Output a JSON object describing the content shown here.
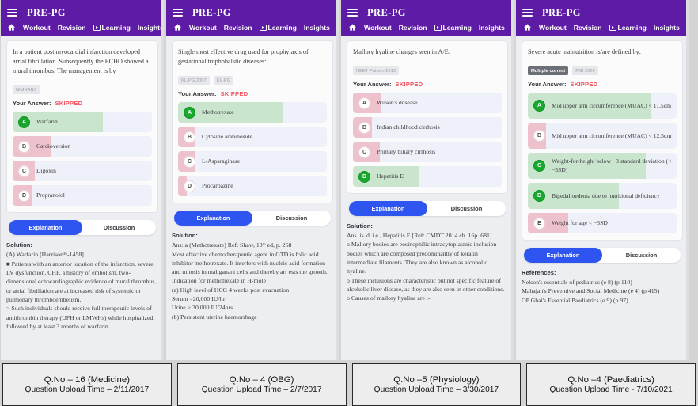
{
  "app": {
    "brand": "PRE-PG",
    "menu_icon": "hamburger-icon",
    "nav": [
      {
        "label": "Workout",
        "icon": ""
      },
      {
        "label": "Revision",
        "icon": ""
      },
      {
        "label": "Learning",
        "icon": "play-video-icon"
      },
      {
        "label": "Insights",
        "icon": ""
      }
    ],
    "home_icon": "home-icon",
    "answer_label": "Your Answer:",
    "answer_value": "SKIPPED",
    "tab_explanation": "Explanation",
    "tab_discussion": "Discussion",
    "solution_heading": "Solution:",
    "references_heading": "References:"
  },
  "colors": {
    "appbar_purple": "#5d1ba6",
    "correct_green": "#17a82e",
    "correct_fill": "#c9e5ce",
    "wrong_fill": "#eec2cd",
    "option_bg": "#eef1f9",
    "active_tab_blue": "#2f55f0",
    "skipped_red": "#f4525f"
  },
  "panels": [
    {
      "question": "In a patient post myocardial infarction developed arrial fibrillation. Subsequently the ECHO showed a mural thrombus. The management is by",
      "tags": [
        {
          "text": "NIMHANS",
          "dark": false
        }
      ],
      "options": [
        {
          "key": "A",
          "text": "Warfarin",
          "state": "correct",
          "fill": 65
        },
        {
          "key": "B",
          "text": "Cardioversion",
          "state": "wrong",
          "fill": 28
        },
        {
          "key": "C",
          "text": "Digoxin",
          "state": "wrong",
          "fill": 16
        },
        {
          "key": "D",
          "text": "Propranolol",
          "state": "wrong",
          "fill": 14
        }
      ],
      "solution_heading": "Solution:",
      "solution": "(A) Warfarin [Harrison¹⁶-1458]\n■ Patients with an anterior location of the infarction, severe LV dysfunction, CHF, a history of embolism, two-dimensional echocardiographic evidence of mural thrombus, or atrial fibrillation are at increased risk of systemic or pulmonary thromboembeiism.\n> Such individuals should receive full therapeutic levels of antithrombin therapy (UFH or LMWHs) while hospitalized, followed by at least 3 months of warfarin",
      "caption_line1": "Q.No – 16 (Medicine)",
      "caption_line2": "Question Upload Time – 2/11/2017"
    },
    {
      "question": "Single most effective drug used for prophylaxis of gestational trophobalstic diseases:",
      "tags": [
        {
          "text": "KL-PG 2007",
          "dark": false
        },
        {
          "text": "KL-PG",
          "dark": false
        }
      ],
      "options": [
        {
          "key": "A",
          "text": "Methotrexate",
          "state": "correct",
          "fill": 71
        },
        {
          "key": "B",
          "text": "Cytosine arabinoside",
          "state": "wrong",
          "fill": 11
        },
        {
          "key": "C",
          "text": "L-Asparaginase",
          "state": "wrong",
          "fill": 11
        },
        {
          "key": "D",
          "text": "Procarbazine",
          "state": "wrong",
          "fill": 6
        }
      ],
      "solution_heading": "Solution:",
      "solution": "Ans: a (Methotrexate) Ref: Shaw, 13ᵗʰ ed, p. 258\nMost effective chemotherapeutic agent in GTD is folic acid inhibitor methotrexate. It interfers with nucleic acid formation and mitosis in maliganant cells and thereby arr ests the growth.\nIndication for methotrexate in H-mole\n(a) High level of HCG 4 weeks post evacuation\nSerum >20,000 IU/ltr\nUrine > 30,000 IU/24hrs\n(b) Persistent uterine haemorrhage",
      "caption_line1": "Q.No – 4 (OBG)",
      "caption_line2": "Question Upload Time – 2/7/2017"
    },
    {
      "question": "Mallory hyaline changes seen in A/E:",
      "tags": [
        {
          "text": "NEET Pattern 2015",
          "dark": false
        }
      ],
      "options": [
        {
          "key": "A",
          "text": "Wilson's dosease",
          "state": "wrong",
          "fill": 19
        },
        {
          "key": "B",
          "text": "Indian childhood cirrhosis",
          "state": "wrong",
          "fill": 13
        },
        {
          "key": "C",
          "text": "Primary biliary cirrhosis",
          "state": "wrong",
          "fill": 18
        },
        {
          "key": "D",
          "text": "Hepatitis E",
          "state": "correct",
          "fill": 44
        }
      ],
      "solution_heading": "Solution:",
      "solution": "Ans. is 'd' i.e., Hepatitis E [Ref: CMDT 2014 ch. 16p. 681]\no Mallory bodies are eosinophilic intracytoplasmic inclusion bodies which are composed predominantly of keratin intermediate filaments. They are also known as alcoholic hyaline.\no These inclusions are characteristic but not specific feature of alcoholic liver disease, as they are also seen in other conditions.\no Causes of mallory hyaline are :-",
      "caption_line1": "Q.No –5 (Physiology)",
      "caption_line2": "Question Upload Time – 3/30/2017"
    },
    {
      "question": "Severe acute malnutrition is/are defined by:",
      "tags": [
        {
          "text": "Multiple correct",
          "dark": true
        },
        {
          "text": "PGI 2020",
          "dark": false
        }
      ],
      "options": [
        {
          "key": "A",
          "text": "Mid upper arm circumference (MUAC) < 11.5cm",
          "state": "correct",
          "fill": 83
        },
        {
          "key": "B",
          "text": "Mid upper arm circumference (MUAC) < 12.5cm",
          "state": "wrong",
          "fill": 12
        },
        {
          "key": "C",
          "text": "Weight-for-height below −3 standard deviation (< −3SD)",
          "state": "correct",
          "fill": 79
        },
        {
          "key": "D",
          "text": "Bipedal oedema due to nutritional deficiency",
          "state": "correct",
          "fill": 61
        },
        {
          "key": "E",
          "text": "Weight for age < −3SD",
          "state": "wrong",
          "fill": 27
        }
      ],
      "solution_heading": "References:",
      "solution": "Nelson's essentials of pediatrics (e 8) (p 110)\nMahajan's Preventive and Social Medicine (e 4) (p 415)\nOP Ghai's Essential Paediatrics (e 9) (p 97)",
      "caption_line1": "Q.No –4 (Paediatrics)",
      "caption_line2": "Question Upload Time -  7/10/2021"
    }
  ]
}
